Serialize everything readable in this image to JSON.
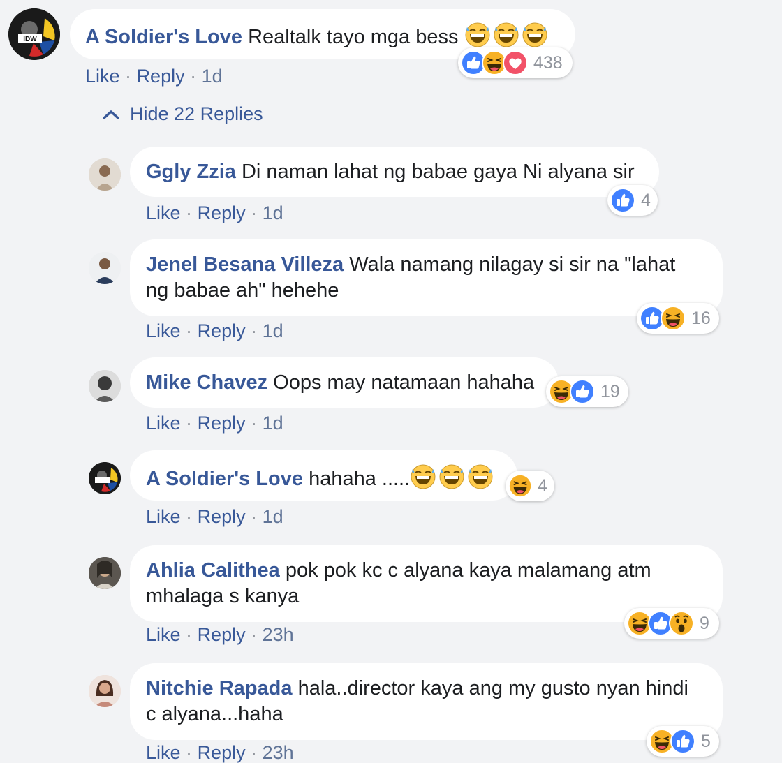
{
  "colors": {
    "link": "#385898",
    "like": "#4080ff",
    "haha": "#f7b125",
    "love": "#f25268",
    "background": "#f2f3f5"
  },
  "main_comment": {
    "author": "A Soldier's Love",
    "text": "Realtalk tayo mga bess",
    "emojis": [
      "grinning-sweat-emoji",
      "grinning-sweat-emoji",
      "grinning-sweat-emoji"
    ],
    "reactions": [
      "like-icon",
      "haha-icon",
      "love-icon"
    ],
    "reaction_count": "438",
    "like": "Like",
    "sep1": "·",
    "reply": "Reply",
    "sep2": "·",
    "time": "1d"
  },
  "replies_toggle": {
    "icon": "chevron-up-icon",
    "label": "Hide 22 Replies"
  },
  "replies": [
    {
      "author": "Ggly Zzia",
      "text": "Di naman lahat ng babae gaya Ni alyana sir",
      "reactions": [
        "like-icon"
      ],
      "reaction_count": "4",
      "like": "Like",
      "sep1": "·",
      "reply": "Reply",
      "sep2": "·",
      "time": "1d"
    },
    {
      "author": "Jenel Besana Villeza",
      "text1": "Wala namang nilagay si sir na \"lahat",
      "text2": "ng babae ah\" hehehe",
      "reactions": [
        "like-icon",
        "haha-icon"
      ],
      "reaction_count": "16",
      "like": "Like",
      "sep1": "·",
      "reply": "Reply",
      "sep2": "·",
      "time": "1d"
    },
    {
      "author": "Mike Chavez",
      "text": "Oops may natamaan hahaha",
      "reactions": [
        "haha-icon",
        "like-icon"
      ],
      "reaction_count": "19",
      "like": "Like",
      "sep1": "·",
      "reply": "Reply",
      "sep2": "·",
      "time": "1d"
    },
    {
      "author": "A Soldier's Love",
      "text": "hahaha .....",
      "emojis": [
        "grinning-sweat-emoji",
        "grinning-sweat-emoji",
        "grinning-sweat-emoji"
      ],
      "reactions": [
        "haha-icon"
      ],
      "reaction_count": "4",
      "like": "Like",
      "sep1": "·",
      "reply": "Reply",
      "sep2": "·",
      "time": "1d"
    },
    {
      "author": "Ahlia Calithea",
      "text1": "pok pok kc c alyana kaya malamang atm",
      "text2": "mhalaga s kanya",
      "reactions": [
        "haha-icon",
        "like-icon",
        "wow-icon"
      ],
      "reaction_count": "9",
      "like": "Like",
      "sep1": "·",
      "reply": "Reply",
      "sep2": "·",
      "time": "23h"
    },
    {
      "author": "Nitchie Rapada",
      "text1": "hala..director kaya ang my gusto nyan hindi",
      "text2": "c alyana...haha",
      "reactions": [
        "haha-icon",
        "like-icon"
      ],
      "reaction_count": "5",
      "like": "Like",
      "sep1": "·",
      "reply": "Reply",
      "sep2": "·",
      "time": "23h"
    }
  ]
}
